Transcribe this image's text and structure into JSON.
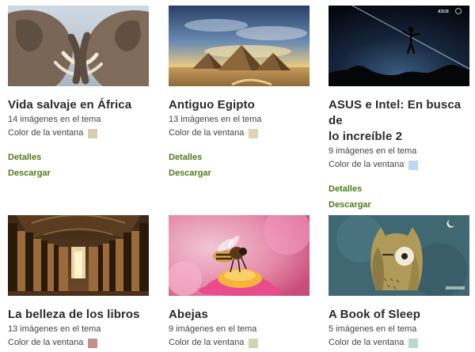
{
  "themes": [
    {
      "title": "Vida salvaje en África",
      "count": "14 imágenes en el tema",
      "window_color_label": "Color de la ventana",
      "swatch_color": "#d8ccb0",
      "details_label": "Detalles",
      "download_label": "Descargar",
      "image": "elephants"
    },
    {
      "title": "Antiguo Egipto",
      "count": "13 imágenes en el tema",
      "window_color_label": "Color de la ventana",
      "swatch_color": "#e0d3b4",
      "details_label": "Detalles",
      "download_label": "Descargar",
      "image": "pyramids"
    },
    {
      "title_line1": "ASUS e Intel: En busca de",
      "title_line2": "lo increíble 2",
      "count": "9 imágenes en el tema",
      "window_color_label": "Color de la ventana",
      "swatch_color": "#bcd8f4",
      "details_label": "Detalles",
      "download_label": "Descargar",
      "image": "tightrope"
    },
    {
      "title": "La belleza de los libros",
      "count": "13 imágenes en el tema",
      "window_color_label": "Color de la ventana",
      "swatch_color": "#c0908a",
      "image": "library"
    },
    {
      "title": "Abejas",
      "count": "9 imágenes en el tema",
      "window_color_label": "Color de la ventana",
      "swatch_color": "#c8d8b0",
      "image": "bee"
    },
    {
      "title": "A Book of Sleep",
      "count": "5 imágenes en el tema",
      "window_color_label": "Color de la ventana",
      "swatch_color": "#b8d8d0",
      "image": "owl"
    }
  ],
  "asus_logo_text": "ASUS",
  "link_color": "#4f7a1a"
}
